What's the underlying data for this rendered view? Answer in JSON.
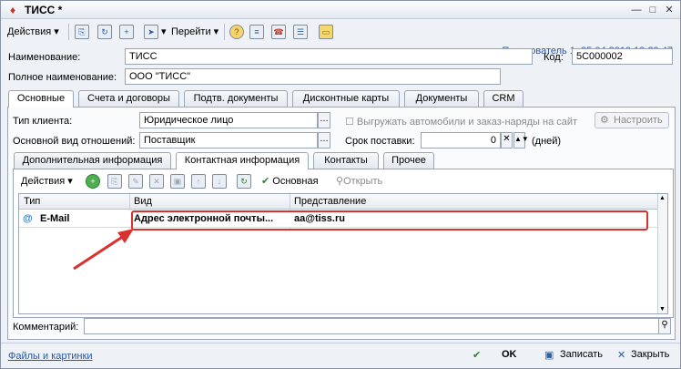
{
  "window": {
    "title": "ТИСС *",
    "minimize": "—",
    "maximize": "□",
    "close": "✕"
  },
  "toolbar": {
    "actions": "Действия",
    "goto": "Перейти",
    "user_info": "Пользователь 1; 25.04.2019 19:29:47"
  },
  "fields": {
    "name_label": "Наименование:",
    "name_value": "ТИСС",
    "code_label": "Код:",
    "code_value": "5С000002",
    "full_name_label": "Полное наименование:",
    "full_name_value": "ООО \"ТИСС\""
  },
  "tabs": [
    "Основные",
    "Счета и договоры",
    "Подтв. документы",
    "Дисконтные карты",
    "Документы",
    "CRM"
  ],
  "main": {
    "client_type_label": "Тип клиента:",
    "client_type_value": "Юридическое лицо",
    "relation_label": "Основной вид отношений:",
    "relation_value": "Поставщик",
    "export_label": "Выгружать автомобили и заказ-наряды на сайт",
    "configure_label": "Настроить",
    "delivery_label": "Срок поставки:",
    "delivery_value": "0",
    "delivery_unit": "(дней)"
  },
  "subtabs": [
    "Дополнительная информация",
    "Контактная информация",
    "Контакты",
    "Прочее"
  ],
  "subtoolbar": {
    "actions": "Действия",
    "main": "Основная",
    "open": "Открыть"
  },
  "grid": {
    "headers": [
      "Тип",
      "Вид",
      "Представление"
    ],
    "rows": [
      {
        "type": "E-Mail",
        "kind": "Адрес электронной почты...",
        "value": "aa@tiss.ru"
      }
    ]
  },
  "comment_label": "Комментарий:",
  "footer": {
    "files_link": "Файлы и картинки",
    "ok": "OK",
    "save": "Записать",
    "close": "Закрыть"
  }
}
